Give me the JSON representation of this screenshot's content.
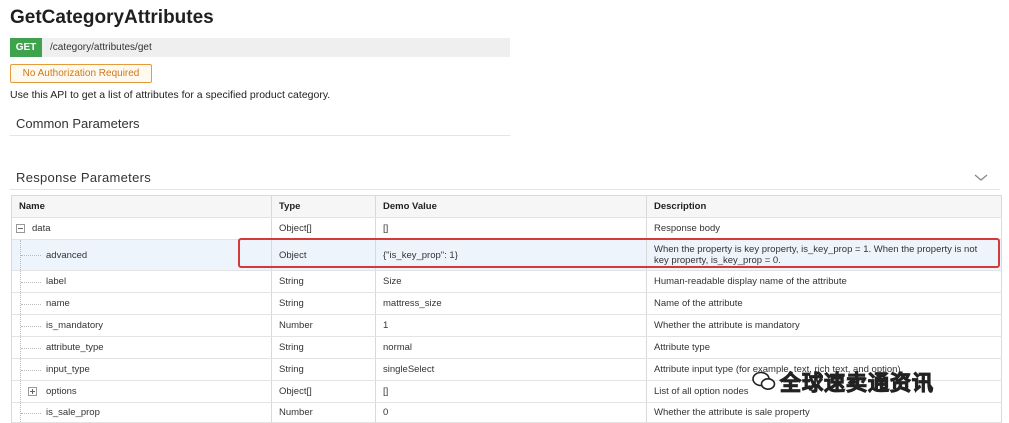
{
  "api": {
    "title": "GetCategoryAttributes",
    "method": "GET",
    "path": "/category/attributes/get",
    "auth_badge": "No Authorization Required",
    "description": "Use this API to get a list of attributes for a specified product category."
  },
  "sections": {
    "common": "Common Parameters",
    "response": "Response Parameters"
  },
  "table": {
    "headers": [
      "Name",
      "Type",
      "Demo Value",
      "Description"
    ],
    "rows": [
      {
        "name": "data",
        "type": "Object[]",
        "demo": "[]",
        "desc": "Response body"
      },
      {
        "name": "advanced",
        "type": "Object",
        "demo": "{\"is_key_prop\": 1}",
        "desc": "When the property is key property, is_key_prop = 1.  When the property is not key property,  is_key_prop = 0."
      },
      {
        "name": "label",
        "type": "String",
        "demo": "Size",
        "desc": "Human-readable display name of the attribute"
      },
      {
        "name": "name",
        "type": "String",
        "demo": "mattress_size",
        "desc": "Name of the attribute"
      },
      {
        "name": "is_mandatory",
        "type": "Number",
        "demo": "1",
        "desc": "Whether the attribute is mandatory"
      },
      {
        "name": "attribute_type",
        "type": "String",
        "demo": "normal",
        "desc": "Attribute type"
      },
      {
        "name": "input_type",
        "type": "String",
        "demo": "singleSelect",
        "desc": "Attribute input type (for example, text, rich text, and option)"
      },
      {
        "name": "options",
        "type": "Object[]",
        "demo": "[]",
        "desc": "List of all option nodes"
      },
      {
        "name": "is_sale_prop",
        "type": "Number",
        "demo": "0",
        "desc": "Whether the attribute is sale property"
      }
    ]
  },
  "watermark": "全球速卖通资讯",
  "colors": {
    "get_badge": "#3fa34d",
    "auth_border": "#e59a3b",
    "highlight_border": "#d33a3a"
  }
}
